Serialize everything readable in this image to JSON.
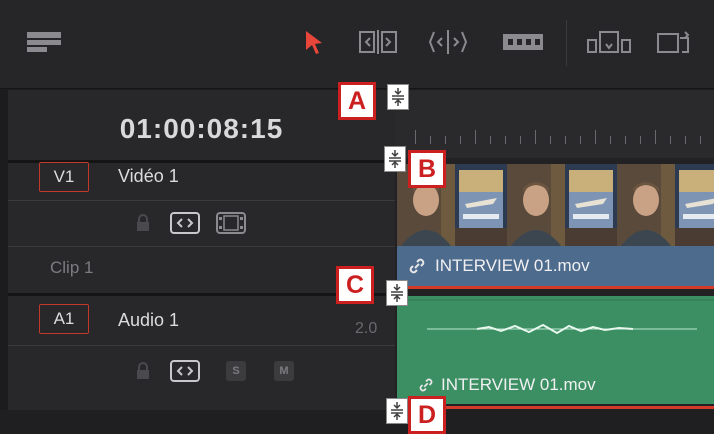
{
  "timecode": "01:00:08:15",
  "tracks": {
    "video": {
      "badge": "V1",
      "name": "Vidéo 1",
      "clip_label": "Clip 1"
    },
    "audio": {
      "badge": "A1",
      "name": "Audio 1",
      "level": "2.0",
      "solo": "S",
      "mute": "M"
    }
  },
  "clips": {
    "video_clip_title": "INTERVIEW 01.mov",
    "audio_clip_title": "INTERVIEW 01.mov"
  },
  "toolbar": {
    "icons": [
      "timeline-view-icon",
      "selection-pointer-icon",
      "trim-edit-icon",
      "dynamic-trim-icon",
      "blade-icon",
      "insert-clip-icon",
      "overwrite-clip-icon"
    ]
  },
  "callouts": {
    "a": "A",
    "b": "B",
    "c": "C",
    "d": "D"
  },
  "colors": {
    "accent_red": "#cc1f1f",
    "video_clip_bar": "#4d6b8c",
    "audio_clip": "#3b8f63",
    "pointer_red": "#e8463a"
  }
}
